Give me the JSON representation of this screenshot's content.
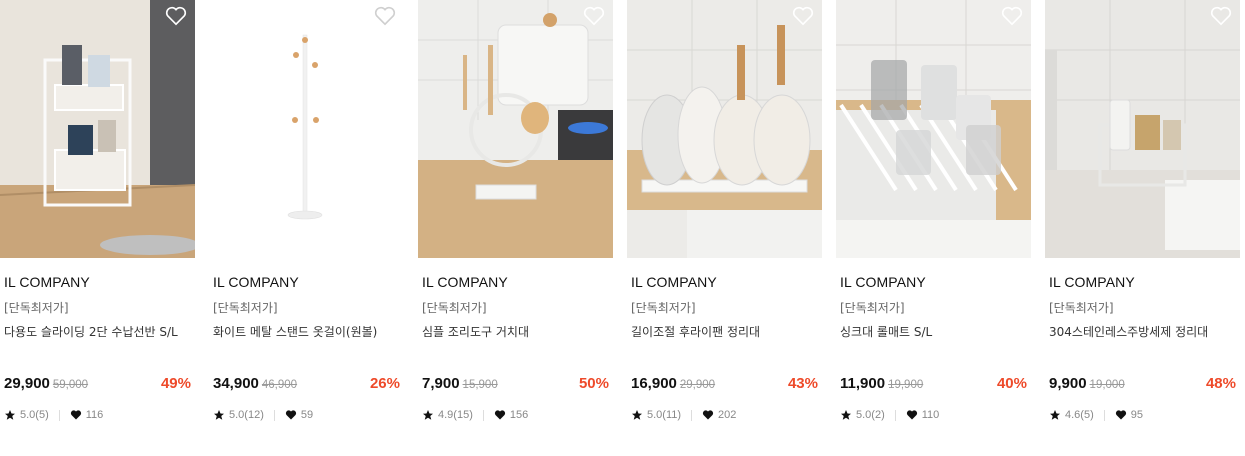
{
  "colors": {
    "discount": "#ee4a2a",
    "price": "#111111",
    "original_price": "#999999"
  },
  "icons": {
    "wishlist": "heart-outline-icon",
    "rating": "star-icon",
    "likes": "heart-icon"
  },
  "products": [
    {
      "brand": "IL COMPANY",
      "tag": "[단독최저가]",
      "name": "다용도 슬라이딩 2단 수납선반 S/L",
      "price": "29,900",
      "original": "59,000",
      "discount": "49%",
      "rating": "5.0(5)",
      "likes": "116"
    },
    {
      "brand": "IL COMPANY",
      "tag": "[단독최저가]",
      "name": "화이트 메탈 스탠드 옷걸이(원볼)",
      "price": "34,900",
      "original": "46,900",
      "discount": "26%",
      "rating": "5.0(12)",
      "likes": "59"
    },
    {
      "brand": "IL COMPANY",
      "tag": "[단독최저가]",
      "name": "심플 조리도구 거치대",
      "price": "7,900",
      "original": "15,900",
      "discount": "50%",
      "rating": "4.9(15)",
      "likes": "156"
    },
    {
      "brand": "IL COMPANY",
      "tag": "[단독최저가]",
      "name": "길이조절 후라이팬 정리대",
      "price": "16,900",
      "original": "29,900",
      "discount": "43%",
      "rating": "5.0(11)",
      "likes": "202"
    },
    {
      "brand": "IL COMPANY",
      "tag": "[단독최저가]",
      "name": "싱크대 롤매트 S/L",
      "price": "11,900",
      "original": "19,900",
      "discount": "40%",
      "rating": "5.0(2)",
      "likes": "110"
    },
    {
      "brand": "IL COMPANY",
      "tag": "[단독최저가]",
      "name": "304스테인레스주방세제 정리대",
      "price": "9,900",
      "original": "19,000",
      "discount": "48%",
      "rating": "4.6(5)",
      "likes": "95"
    }
  ]
}
